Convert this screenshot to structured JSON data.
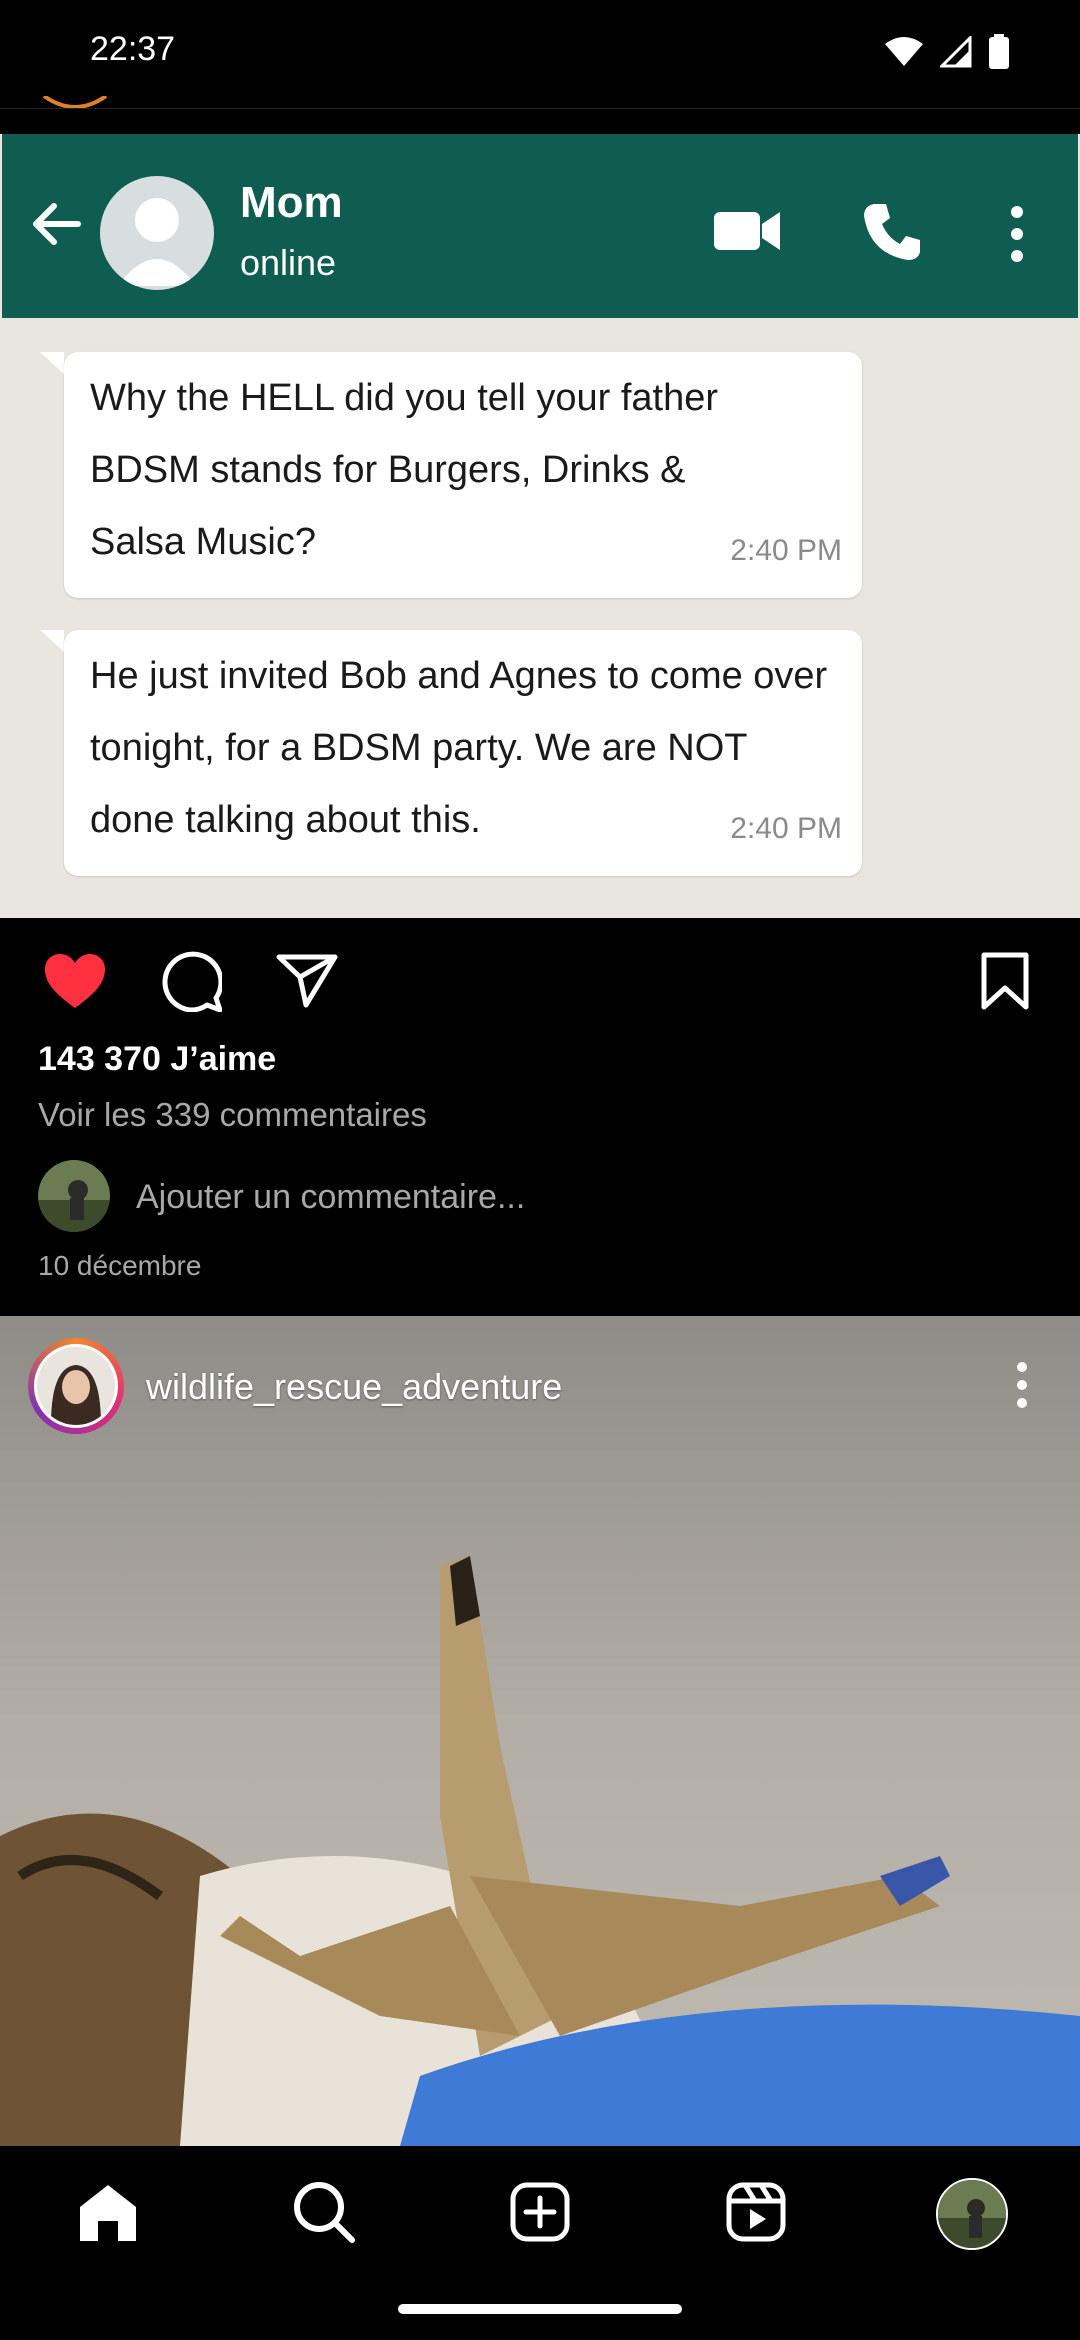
{
  "status_bar": {
    "time": "22:37",
    "icons": [
      "wifi-icon",
      "cell-signal-icon",
      "battery-icon"
    ]
  },
  "post1": {
    "image": {
      "chat": {
        "contact_name": "Mom",
        "contact_status": "online",
        "messages": [
          {
            "text": "Why the HELL did you tell your father BDSM stands for Burgers, Drinks & Salsa Music?",
            "time": "2:40 PM"
          },
          {
            "text": "He just invited Bob and Agnes to come over tonight, for a BDSM party. We are NOT done talking about this.",
            "time": "2:40 PM"
          }
        ],
        "header_color": "#0f5c50"
      }
    },
    "actions": {
      "like_icon": "heart-filled-icon",
      "comment_icon": "comment-icon",
      "share_icon": "send-icon",
      "save_icon": "bookmark-icon",
      "liked_color": "#ff3040"
    },
    "likes": "143 370 J’aime",
    "view_comments": "Voir les 339 commentaires",
    "add_comment_placeholder": "Ajouter un commentaire...",
    "date": "10 décembre"
  },
  "post2": {
    "username": "wildlife_rescue_adventure",
    "menu_icon": "more-vertical-icon"
  },
  "bottom_nav": {
    "items": [
      "home-icon",
      "search-icon",
      "create-icon",
      "reels-icon",
      "profile-avatar"
    ]
  }
}
